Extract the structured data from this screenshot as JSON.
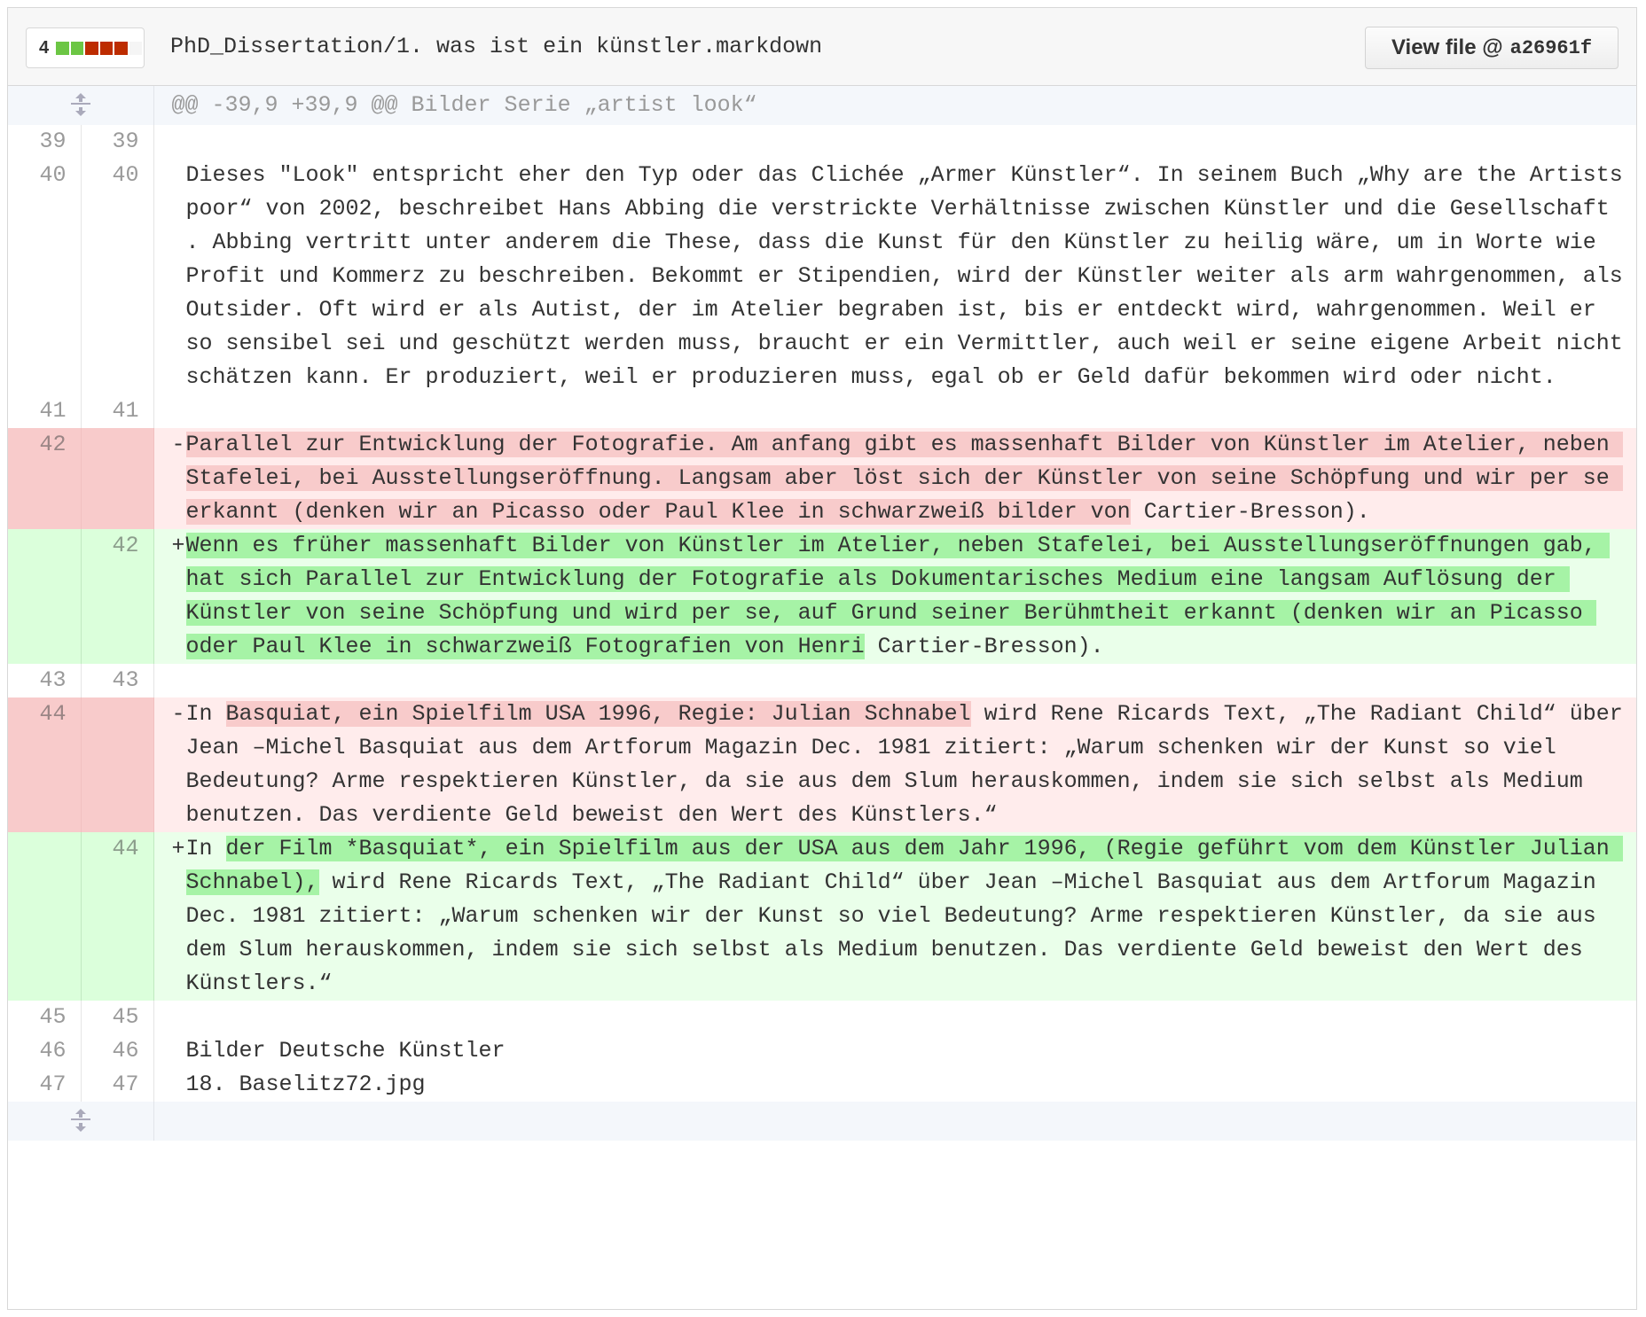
{
  "file_header": {
    "diffstat_count": "4",
    "diffstat_blocks": [
      "#6cc644",
      "#6cc644",
      "#bd2c00",
      "#bd2c00",
      "#bd2c00",
      "#f5f5f5"
    ],
    "file_path": "PhD_Dissertation/1. was ist ein künstler.markdown",
    "view_file_label": "View file @",
    "commit_sha": "a26961f"
  },
  "hunk": {
    "header": "@@ -39,9 +39,9 @@ Bilder Serie „artist look“"
  },
  "lines": {
    "l39": {
      "old": "39",
      "new": "39",
      "text": ""
    },
    "l40": {
      "old": "40",
      "new": "40",
      "text": "Dieses \"Look\" entspricht eher den Typ oder das Clichée „Armer Künstler“. In seinem Buch „Why are the Artists poor“ von 2002, beschreibet Hans Abbing die verstrickte Verhältnisse zwischen Künstler und die Gesellschaft . Abbing vertritt unter anderem die These, dass die Kunst für den Künstler zu heilig wäre, um in Worte wie Profit und Kommerz zu beschreiben. Bekommt er Stipendien, wird der Künstler weiter als arm wahrgenommen, als Outsider. Oft wird er als Autist, der im Atelier begraben ist, bis er entdeckt wird, wahrgenommen. Weil er so sensibel sei und geschützt werden muss, braucht er ein Vermittler, auch weil er seine eigene Arbeit nicht schätzen kann. Er produziert, weil er produzieren muss, egal ob er Geld dafür bekommen wird oder nicht."
    },
    "l41": {
      "old": "41",
      "new": "41",
      "text": ""
    },
    "d42": {
      "old": "42",
      "sign": "-",
      "hl": "Parallel zur Entwicklung der Fotografie. Am anfang gibt es massenhaft Bilder von Künstler im Atelier, neben Stafelei, bei Ausstellungseröffnung. Langsam aber löst sich der Künstler von seine Schöpfung und wir per se erkannt (denken wir an Picasso oder Paul Klee in schwarzweiß bilder von",
      "rest": " Cartier-Bresson)."
    },
    "a42": {
      "new": "42",
      "sign": "+",
      "hl": "Wenn es früher massenhaft Bilder von Künstler im Atelier, neben Stafelei, bei Ausstellungseröffnungen gab, hat sich Parallel zur Entwicklung der Fotografie als Dokumentarisches Medium eine langsam Auflösung der Künstler von seine Schöpfung und wird per se, auf Grund seiner Berühmtheit erkannt (denken wir an Picasso oder Paul Klee in schwarzweiß Fotografien von Henri",
      "rest": " Cartier-Bresson)."
    },
    "l43": {
      "old": "43",
      "new": "43",
      "text": ""
    },
    "d44": {
      "old": "44",
      "sign": "-",
      "pre": "In ",
      "hl": "Basquiat, ein Spielfilm USA 1996, Regie: Julian Schnabel",
      "rest": " wird Rene Ricards Text, „The Radiant Child“ über Jean –Michel Basquiat aus dem Artforum Magazin Dec. 1981 zitiert: „Warum schenken wir der Kunst so viel Bedeutung? Arme respektieren Künstler, da sie aus dem Slum herauskommen, indem sie sich selbst als Medium benutzen. Das verdiente Geld beweist den Wert des Künstlers.“"
    },
    "a44": {
      "new": "44",
      "sign": "+",
      "pre": "In ",
      "hl": "der Film *Basquiat*, ein Spielfilm aus der USA aus dem Jahr 1996, (Regie geführt vom dem Künstler Julian Schnabel),",
      "rest": " wird Rene Ricards Text, „The Radiant Child“ über Jean –Michel Basquiat aus dem Artforum Magazin Dec. 1981 zitiert: „Warum schenken wir der Kunst so viel Bedeutung? Arme respektieren Künstler, da sie aus dem Slum herauskommen, indem sie sich selbst als Medium benutzen. Das verdiente Geld beweist den Wert des Künstlers.“"
    },
    "l45": {
      "old": "45",
      "new": "45",
      "text": ""
    },
    "l46": {
      "old": "46",
      "new": "46",
      "text": "Bilder Deutsche Künstler"
    },
    "l47": {
      "old": "47",
      "new": "47",
      "text": "18. Baselitz72.jpg"
    }
  },
  "icons": {
    "expand_top": "unfold-icon",
    "expand_bottom": "unfold-icon"
  }
}
